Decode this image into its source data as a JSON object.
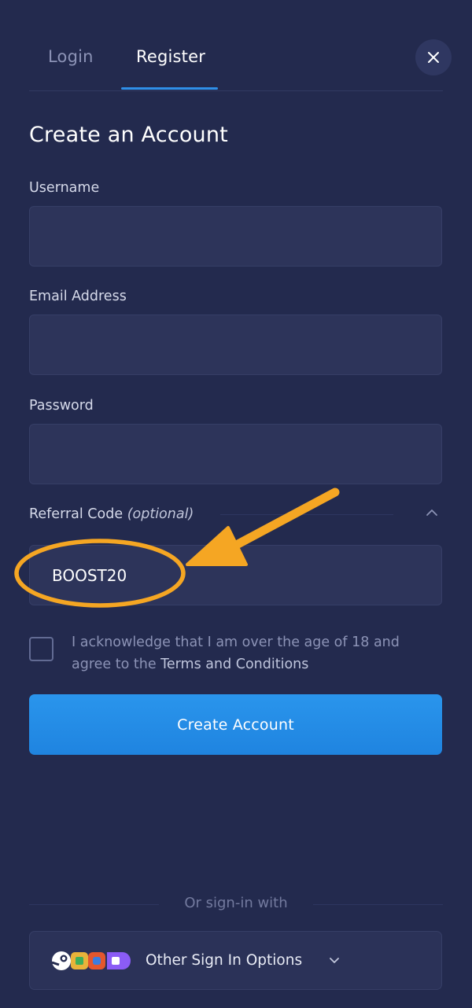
{
  "tabs": {
    "login": "Login",
    "register": "Register"
  },
  "heading": "Create an Account",
  "form": {
    "username_label": "Username",
    "email_label": "Email Address",
    "password_label": "Password",
    "referral_label": "Referral Code",
    "referral_optional": "(optional)",
    "referral_value": "BOOST20",
    "terms_prefix": "I acknowledge that I am over the age of 18 and agree to the ",
    "terms_link": "Terms and Conditions",
    "submit_label": "Create Account"
  },
  "signin": {
    "divider_text": "Or sign-in with",
    "other_options_label": "Other Sign In Options"
  },
  "colors": {
    "background": "#232a4e",
    "accent": "#1f84e0",
    "annotation": "#f5a623"
  },
  "icons": {
    "close": "close-icon",
    "chevron_up": "chevron-up-icon",
    "chevron_down": "chevron-down-icon",
    "providers": [
      "steam-icon",
      "provider-icon",
      "provider-icon",
      "provider-icon"
    ]
  }
}
